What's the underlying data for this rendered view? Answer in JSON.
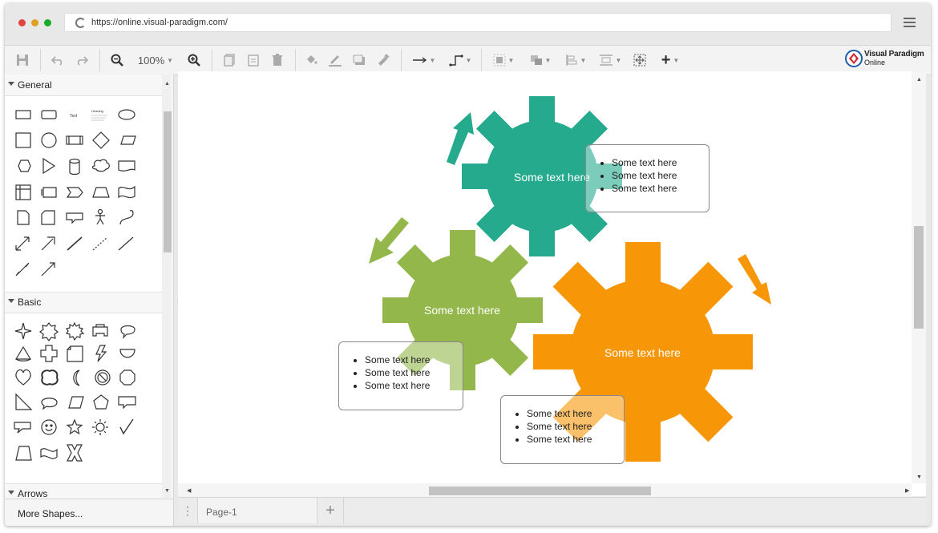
{
  "browser": {
    "url": "https://online.visual-paradigm.com/",
    "traffic_lights": [
      "#e0443e",
      "#dea123",
      "#1aab29"
    ]
  },
  "toolbar": {
    "zoom_level": "100%",
    "brand_name": "Visual Paradigm",
    "brand_sub": "Online"
  },
  "sidebar": {
    "sections": [
      {
        "label": "General"
      },
      {
        "label": "Basic"
      },
      {
        "label": "Arrows"
      }
    ],
    "general_text_shape": "Text",
    "general_heading_shape": "Heading",
    "more_shapes": "More Shapes..."
  },
  "pages": {
    "tabs": [
      {
        "label": "Page-1"
      }
    ],
    "add_icon": "plus-icon"
  },
  "diagram": {
    "colors": {
      "teal": "#25aa8e",
      "green": "#93b74a",
      "orange": "#f79707"
    },
    "gears": [
      {
        "label": "Some text here",
        "color": "#25aa8e"
      },
      {
        "label": "Some text here",
        "color": "#93b74a"
      },
      {
        "label": "Some text here",
        "color": "#f79707"
      }
    ],
    "callouts": [
      {
        "items": [
          "Some text here",
          "Some text here",
          "Some text here"
        ]
      },
      {
        "items": [
          "Some text here",
          "Some text here",
          "Some text here"
        ]
      },
      {
        "items": [
          "Some text here",
          "Some text here",
          "Some text here"
        ]
      }
    ]
  }
}
